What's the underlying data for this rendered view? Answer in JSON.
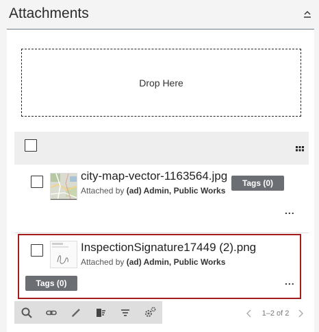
{
  "header": {
    "title": "Attachments",
    "collapse_icon": "chevron-up-icon"
  },
  "drop_zone": {
    "label": "Drop Here"
  },
  "list_header": {
    "select_all_icon": "checkbox-icon",
    "view_toggle_icon": "grid-view-icon"
  },
  "items": [
    {
      "file_name": "city-map-vector-1163564.jpg",
      "attached_prefix": "Attached by",
      "attached_by": "(ad) Admin, Public Works",
      "tags_label": "Tags (0)",
      "more_label": "...",
      "thumbnail": "city-map-thumbnail"
    },
    {
      "file_name": "InspectionSignature17449 (2).png",
      "attached_prefix": "Attached by",
      "attached_by": "(ad) Admin, Public Works",
      "tags_label": "Tags (0)",
      "more_label": "...",
      "thumbnail": "signature-thumbnail"
    }
  ],
  "toolbar": {
    "tools": [
      "search-icon",
      "link-icon",
      "pencil-icon",
      "delete-icon",
      "filter-icon",
      "settings-icon"
    ]
  },
  "pager": {
    "label": "1–2 of 2"
  },
  "colors": {
    "selection_outline": "#a31b1b",
    "tag_button": "#6b6e73",
    "header_line": "#6d7d88"
  }
}
